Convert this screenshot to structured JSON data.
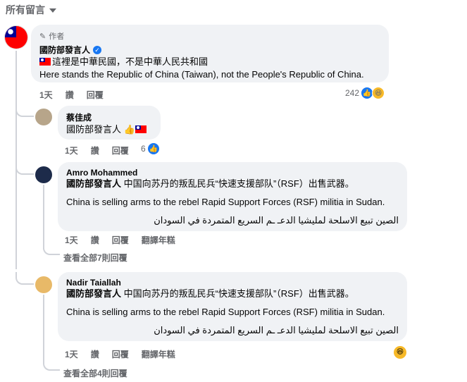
{
  "sort": {
    "label": "所有留言"
  },
  "main_comment": {
    "author_tag": "作者",
    "author": "國防部發言人",
    "line_zh": "這裡是中華民國，不是中華人民共和國",
    "line_en": "Here stands the Republic of China (Taiwan), not the People's Republic of China.",
    "time": "1天",
    "like": "讚",
    "reply": "回覆",
    "reaction_count": "242"
  },
  "replies": [
    {
      "author": "蔡佳成",
      "text": "國防部發言人",
      "time": "1天",
      "like": "讚",
      "reply": "回覆",
      "reaction_count": "6"
    },
    {
      "author": "Amro Mohammed",
      "mention": "國防部發言人",
      "line_zh": "中国向苏丹的叛乱民兵“快速支援部队”（RSF）出售武器。",
      "line_en": "China is selling arms to the rebel Rapid Support Forces (RSF) militia in Sudan.",
      "line_ar": "الصين تبيع الاسلحة لمليشيا الدعـ ـم السريع المتمردة في السودان",
      "time": "1天",
      "like": "讚",
      "reply": "回覆",
      "translate": "翻譯年糕",
      "view_all": "查看全部7則回覆"
    },
    {
      "author": "Nadir Taiallah",
      "mention": "國防部發言人",
      "line_zh": "中国向苏丹的叛乱民兵“快速支援部队”（RSF）出售武器。",
      "line_en": "China is selling arms to the rebel Rapid Support Forces (RSF) militia in Sudan.",
      "line_ar": "الصين تبيع الاسلحة لمليشيا الدعـ ـم السريع المتمردة في السودان",
      "time": "1天",
      "like": "讚",
      "reply": "回覆",
      "translate": "翻譯年糕",
      "view_all": "查看全部4則回覆"
    }
  ],
  "colors": {
    "bubble": "#f0f2f5",
    "secondary_text": "#65676b",
    "facebook_blue": "#1877f2",
    "haha_yellow": "#f7b928"
  },
  "icons": {
    "sort_caret": "caret-down-icon",
    "author_tag": "pencil-icon",
    "verified": "verified-badge-icon",
    "like_reaction": "like-reaction-icon",
    "haha_reaction": "haha-reaction-icon",
    "thumbs_up_emoji": "thumbs-up-emoji-icon",
    "taiwan_flag": "taiwan-flag-icon"
  }
}
